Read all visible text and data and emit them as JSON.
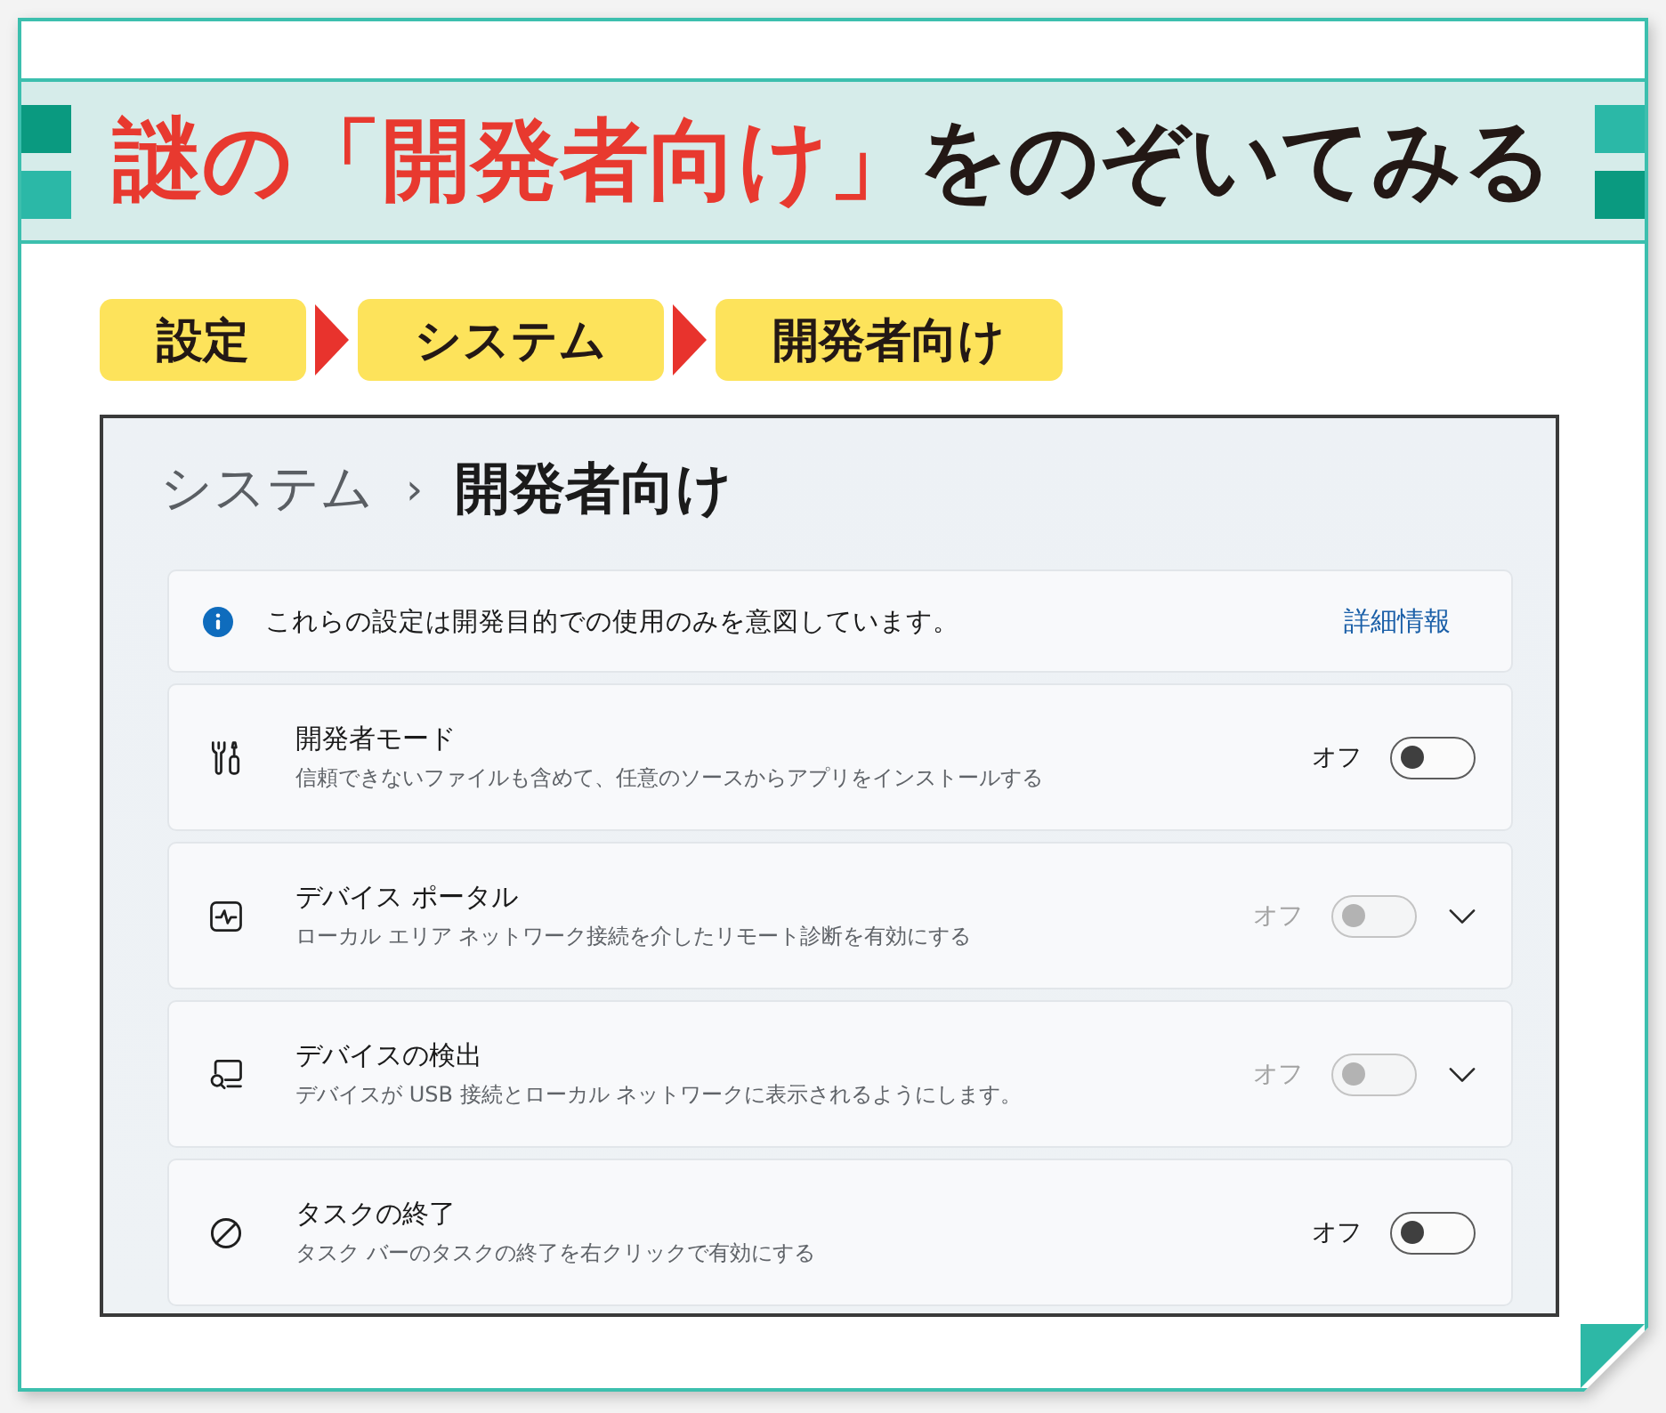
{
  "header": {
    "title_accent": "謎の「開発者向け」",
    "title_rest": "をのぞいてみる"
  },
  "path": [
    {
      "label": "設定"
    },
    {
      "label": "システム"
    },
    {
      "label": "開発者向け"
    }
  ],
  "window": {
    "parent": "システム",
    "separator": "›",
    "title": "開発者向け"
  },
  "notice": {
    "text": "これらの設定は開発目的での使用のみを意図しています。",
    "link": "詳細情報"
  },
  "settings": [
    {
      "title": "開発者モード",
      "description": "信頼できないファイルも含めて、任意のソースからアプリをインストールする",
      "state_label": "オフ",
      "on": false,
      "disabled": false,
      "expandable": false
    },
    {
      "title": "デバイス ポータル",
      "description": "ローカル エリア ネットワーク接続を介したリモート診断を有効にする",
      "state_label": "オフ",
      "on": false,
      "disabled": true,
      "expandable": true
    },
    {
      "title": "デバイスの検出",
      "description": "デバイスが USB 接続とローカル ネットワークに表示されるようにします。",
      "state_label": "オフ",
      "on": false,
      "disabled": true,
      "expandable": true
    },
    {
      "title": "タスクの終了",
      "description": "タスク バーのタスクの終了を右クリックで有効にする",
      "state_label": "オフ",
      "on": false,
      "disabled": false,
      "expandable": false
    }
  ]
}
